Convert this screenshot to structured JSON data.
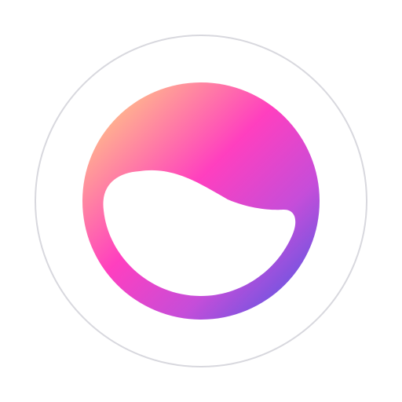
{
  "logo": {
    "icon": "gradient-blob-logo",
    "ring_color": "#D8D8DE",
    "background_color": "#FFFFFF",
    "gradient_colors": [
      "#FFE27A",
      "#FF3FBF",
      "#C64DD9",
      "#3D5AE6"
    ]
  }
}
